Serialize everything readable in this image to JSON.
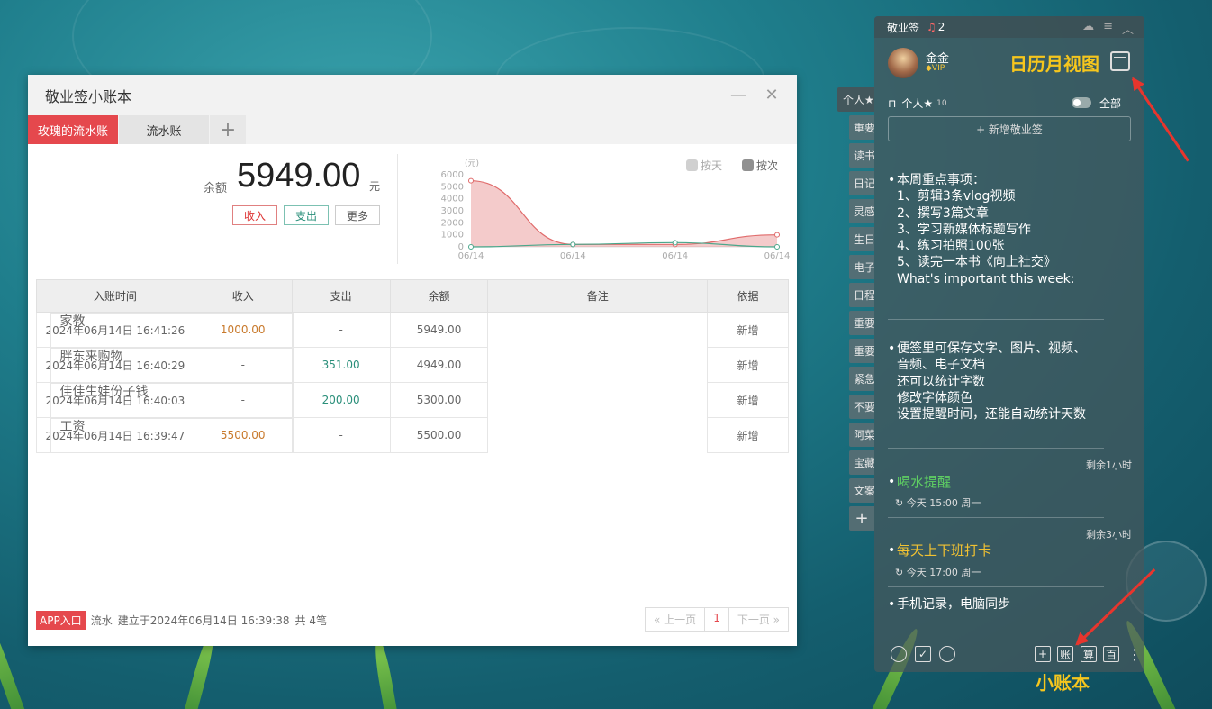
{
  "ledger": {
    "title": "敬业签小账本",
    "minimize": "—",
    "close": "✕",
    "tabs": [
      {
        "label": "玫瑰的流水账",
        "active": true
      },
      {
        "label": "流水账",
        "active": false
      }
    ],
    "add_tab": "+",
    "balance_label": "余额",
    "balance": "5949.00",
    "balance_unit": "元",
    "buttons": {
      "income": "收入",
      "expense": "支出",
      "more": "更多"
    },
    "table": {
      "headers": [
        "入账时间",
        "收入",
        "支出",
        "余额",
        "备注",
        "依据"
      ],
      "rows": [
        {
          "time": "2024年06月14日 16:41:26",
          "income": "1000.00",
          "expense": "-",
          "balance": "5949.00",
          "note": "家教",
          "basis": "新增"
        },
        {
          "time": "2024年06月14日 16:40:29",
          "income": "-",
          "expense": "351.00",
          "balance": "4949.00",
          "note": "胖东来购物",
          "basis": "新增"
        },
        {
          "time": "2024年06月14日 16:40:03",
          "income": "-",
          "expense": "200.00",
          "balance": "5300.00",
          "note": "佳佳生娃份子钱",
          "basis": "新增"
        },
        {
          "time": "2024年06月14日 16:39:47",
          "income": "5500.00",
          "expense": "-",
          "balance": "5500.00",
          "note": "工资",
          "basis": "新增"
        }
      ]
    },
    "footer": {
      "app_entry": "APP入口",
      "type": "流水",
      "created": "建立于2024年06月14日 16:39:38",
      "count": "共 4笔"
    },
    "pager": {
      "prev": "« 上一页",
      "current": "1",
      "next": "下一页 »"
    }
  },
  "chart_data": {
    "type": "area",
    "unit_label": "(元)",
    "legend": [
      {
        "name": "按天",
        "color": "#d0d0d0"
      },
      {
        "name": "按次",
        "color": "#909090"
      }
    ],
    "x": [
      "06/14",
      "06/14",
      "06/14",
      "06/14"
    ],
    "ylim": [
      0,
      6000
    ],
    "yticks": [
      0,
      1000,
      2000,
      3000,
      4000,
      5000,
      6000
    ],
    "series": [
      {
        "values": [
          5500,
          200,
          200,
          1000
        ],
        "color": "#e06a6a"
      },
      {
        "values": [
          0,
          200,
          351,
          0
        ],
        "color": "#4aa88c"
      }
    ]
  },
  "tags": {
    "items": [
      "个人★",
      "重要",
      "读书",
      "日记",
      "灵感",
      "生日",
      "电子",
      "日程",
      "重要",
      "重要",
      "紧急",
      "不要",
      "阿菜",
      "宝藏",
      "文案"
    ],
    "add": "+"
  },
  "panel": {
    "app_name": "敬业签",
    "alert_count": "2",
    "user": "金金",
    "vip": "VIP",
    "callout_calendar": "日历月视图",
    "filter": {
      "label": "个人★",
      "count": "10",
      "scope": "全部"
    },
    "new_note": "+ 新增敬业签",
    "notes": [
      {
        "text": "本周重点事项：\n1、剪辑3条vlog视频\n2、撰写3篇文章\n3、学习新媒体标题写作\n4、练习拍照100张\n5、读完一本书《向上社交》\nWhat's important this week:"
      },
      {
        "text": "便签里可保存文字、图片、视频、\n音频、电子文档\n还可以统计字数\n修改字体颜色\n设置提醒时间，还能自动统计天数"
      },
      {
        "text": "喝水提醒",
        "remain": "剩余1小时",
        "meta": "今天 15:00 周一",
        "color": "#5fcf63"
      },
      {
        "text": "每天上下班打卡",
        "remain": "剩余3小时",
        "meta": "今天 17:00 周一",
        "color": "#f2c232"
      },
      {
        "text": "手机记录，电脑同步"
      }
    ],
    "bottom_icons": {
      "add": "+",
      "account": "账",
      "calc": "算",
      "hundred": "百"
    },
    "callout_ledger": "小账本"
  }
}
